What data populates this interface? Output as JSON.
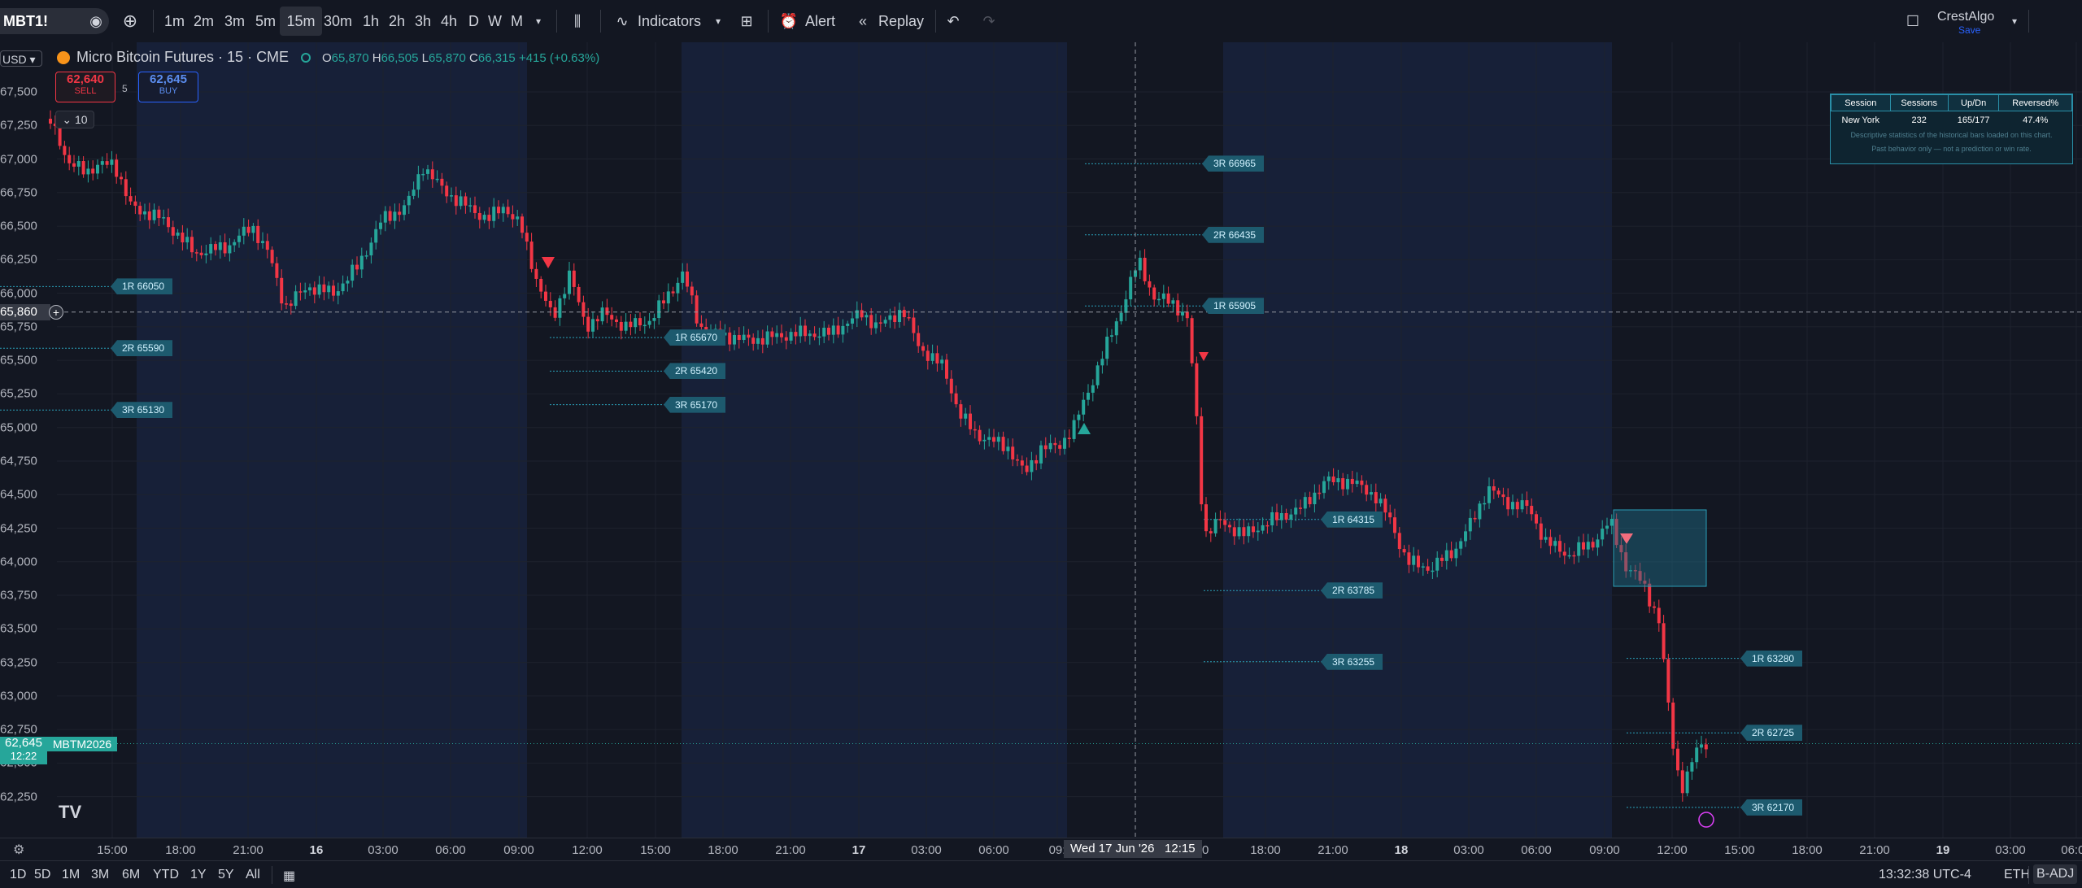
{
  "symbol": "MBT1!",
  "timeframes": [
    "1m",
    "2m",
    "3m",
    "5m",
    "15m",
    "30m",
    "1h",
    "2h",
    "3h",
    "4h",
    "D",
    "W",
    "M"
  ],
  "active_timeframe": "15m",
  "toolbar": {
    "indicators": "Indicators",
    "alert": "Alert",
    "replay": "Replay"
  },
  "account": {
    "name": "CrestAlgo",
    "save": "Save"
  },
  "legend": {
    "currency": "USD",
    "title": "Micro Bitcoin Futures · 15 · CME",
    "o_label": "O",
    "o": "65,870",
    "h_label": "H",
    "h": "66,505",
    "l_label": "L",
    "l": "65,870",
    "c_label": "C",
    "c": "66,315",
    "change": "+415 (+0.63%)"
  },
  "trade": {
    "sell_price": "62,640",
    "sell_label": "SELL",
    "spread": "5",
    "buy_price": "62,645",
    "buy_label": "BUY",
    "qty": "10"
  },
  "price_axis": [
    "67,500",
    "67,250",
    "67,000",
    "66,750",
    "66,500",
    "66,250",
    "66,000",
    "65,750",
    "65,500",
    "65,250",
    "65,000",
    "64,750",
    "64,500",
    "64,250",
    "64,000",
    "63,750",
    "63,500",
    "63,250",
    "63,000",
    "62,750",
    "62,500",
    "62,250"
  ],
  "crosshair_price": "65,860",
  "last_price": {
    "price": "62,645",
    "time": "12:22",
    "ticker": "MBTM2026"
  },
  "time_axis": [
    "15:00",
    "18:00",
    "21:00",
    "16",
    "03:00",
    "06:00",
    "09:00",
    "12:00",
    "15:00",
    "18:00",
    "21:00",
    "17",
    "03:00",
    "06:00",
    "09:",
    "18:00",
    "21:00",
    "18",
    "03:00",
    "06:00",
    "09:00",
    "12:00",
    "15:00",
    "18:00",
    "21:00",
    "19",
    "03:00",
    "06:00"
  ],
  "crosshair_time": {
    "date": "Wed 17 Jun '26",
    "time": "12:15"
  },
  "time_tail": "0",
  "r_labels": [
    {
      "text": "1R 66050"
    },
    {
      "text": "2R 65590"
    },
    {
      "text": "3R 65130"
    },
    {
      "text": "1R 65670"
    },
    {
      "text": "2R 65420"
    },
    {
      "text": "3R 65170"
    },
    {
      "text": "3R 66965"
    },
    {
      "text": "2R 66435"
    },
    {
      "text": "1R 65905"
    },
    {
      "text": "1R 64315"
    },
    {
      "text": "2R 63785"
    },
    {
      "text": "3R 63255"
    },
    {
      "text": "1R 63280"
    },
    {
      "text": "2R 62725"
    },
    {
      "text": "3R 62170"
    }
  ],
  "stats": {
    "headers": [
      "Session",
      "Sessions",
      "Up/Dn",
      "Reversed%"
    ],
    "row": [
      "New York",
      "232",
      "165/177",
      "47.4%"
    ],
    "note1": "Descriptive statistics of the historical bars loaded on this chart.",
    "note2": "Past behavior only — not a prediction or win rate."
  },
  "ranges": [
    "1D",
    "5D",
    "1M",
    "3M",
    "6M",
    "YTD",
    "1Y",
    "5Y",
    "All"
  ],
  "clock": "13:32:38 UTC-4",
  "session": "ETH",
  "adj": "B-ADJ",
  "colors": {
    "up": "#26a69a",
    "down": "#f23645",
    "accent": "#2962ff",
    "label": "#1d5a6e"
  }
}
